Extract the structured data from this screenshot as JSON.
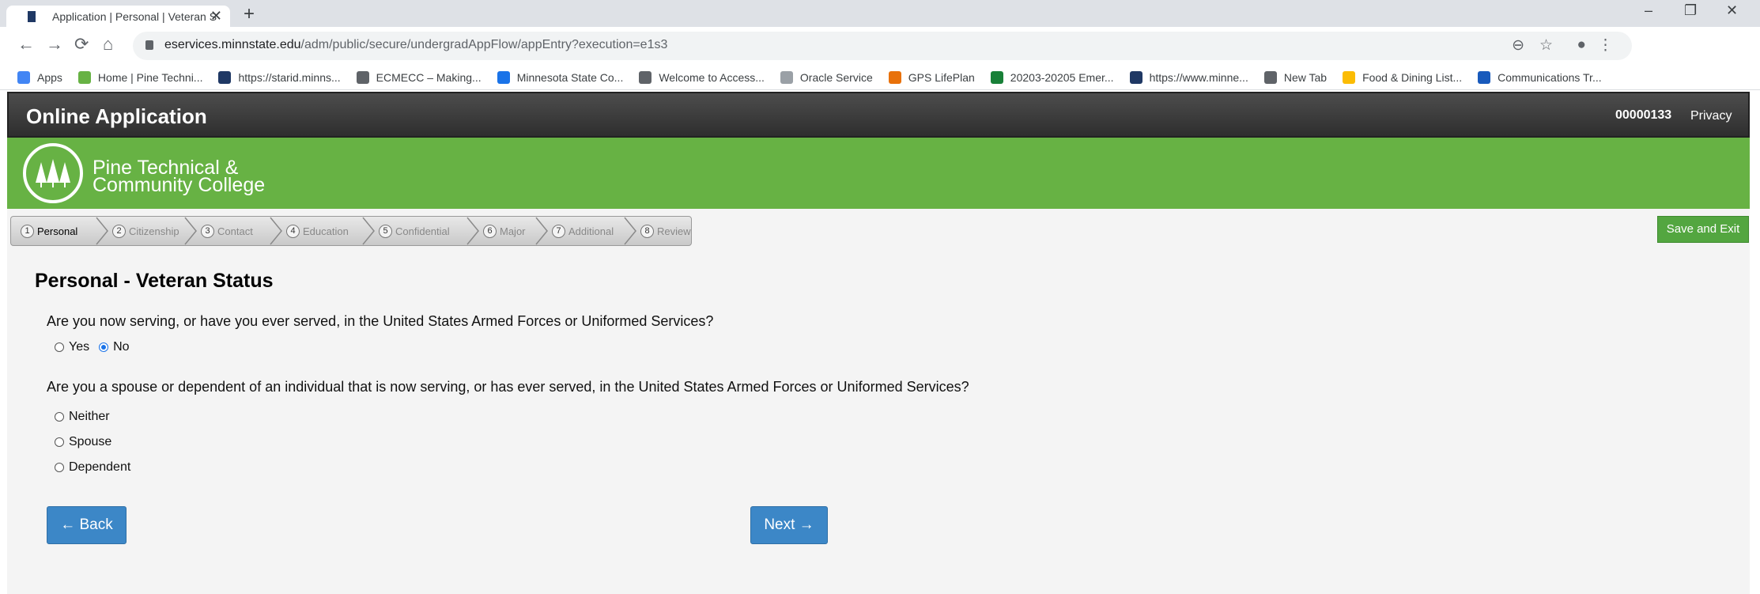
{
  "browser": {
    "tab_title": "Application | Personal | Veteran S",
    "url_host": "eservices.minnstate.edu",
    "url_path": "/adm/public/secure/undergradAppFlow/appEntry?execution=e1s3",
    "bookmarks": [
      {
        "label": "Apps",
        "color": "#4285f4"
      },
      {
        "label": "Home | Pine Techni...",
        "color": "#67b244"
      },
      {
        "label": "https://starid.minns...",
        "color": "#1f3864"
      },
      {
        "label": "ECMECC – Making...",
        "color": "#5f6368"
      },
      {
        "label": "Minnesota State Co...",
        "color": "#1a73e8"
      },
      {
        "label": "Welcome to Access...",
        "color": "#5f6368"
      },
      {
        "label": "Oracle Service",
        "color": "#9aa0a6"
      },
      {
        "label": "GPS LifePlan",
        "color": "#e8710a"
      },
      {
        "label": "20203-20205 Emer...",
        "color": "#188038"
      },
      {
        "label": "https://www.minne...",
        "color": "#1f3864"
      },
      {
        "label": "New Tab",
        "color": "#5f6368"
      },
      {
        "label": "Food & Dining List...",
        "color": "#fbbc04"
      },
      {
        "label": "Communications Tr...",
        "color": "#185abc"
      }
    ]
  },
  "header": {
    "title": "Online Application",
    "id": "00000133",
    "privacy": "Privacy"
  },
  "banner": {
    "college_line1": "Pine Technical &",
    "college_line2": "Community College"
  },
  "steps": [
    {
      "num": "1",
      "label": "Personal",
      "active": true
    },
    {
      "num": "2",
      "label": "Citizenship",
      "active": false
    },
    {
      "num": "3",
      "label": "Contact",
      "active": false
    },
    {
      "num": "4",
      "label": "Education",
      "active": false
    },
    {
      "num": "5",
      "label": "Confidential",
      "active": false
    },
    {
      "num": "6",
      "label": "Major",
      "active": false
    },
    {
      "num": "7",
      "label": "Additional",
      "active": false
    },
    {
      "num": "8",
      "label": "Review",
      "active": false
    }
  ],
  "save_exit": "Save and Exit",
  "section_title": "Personal - Veteran Status",
  "question1": {
    "text": "Are you now serving, or have you ever served, in the United States Armed Forces or Uniformed Services?",
    "options": [
      "Yes",
      "No"
    ],
    "selected": "No"
  },
  "question2": {
    "text": "Are you a spouse or dependent of an individual that is now serving, or has ever served, in the United States Armed Forces or Uniformed Services?",
    "options": [
      "Neither",
      "Spouse",
      "Dependent"
    ],
    "selected": ""
  },
  "buttons": {
    "back": "← Back",
    "next": "Next →"
  },
  "colors": {
    "banner_green": "#67b244",
    "button_blue": "#3c87c7",
    "save_green": "#53a640"
  }
}
